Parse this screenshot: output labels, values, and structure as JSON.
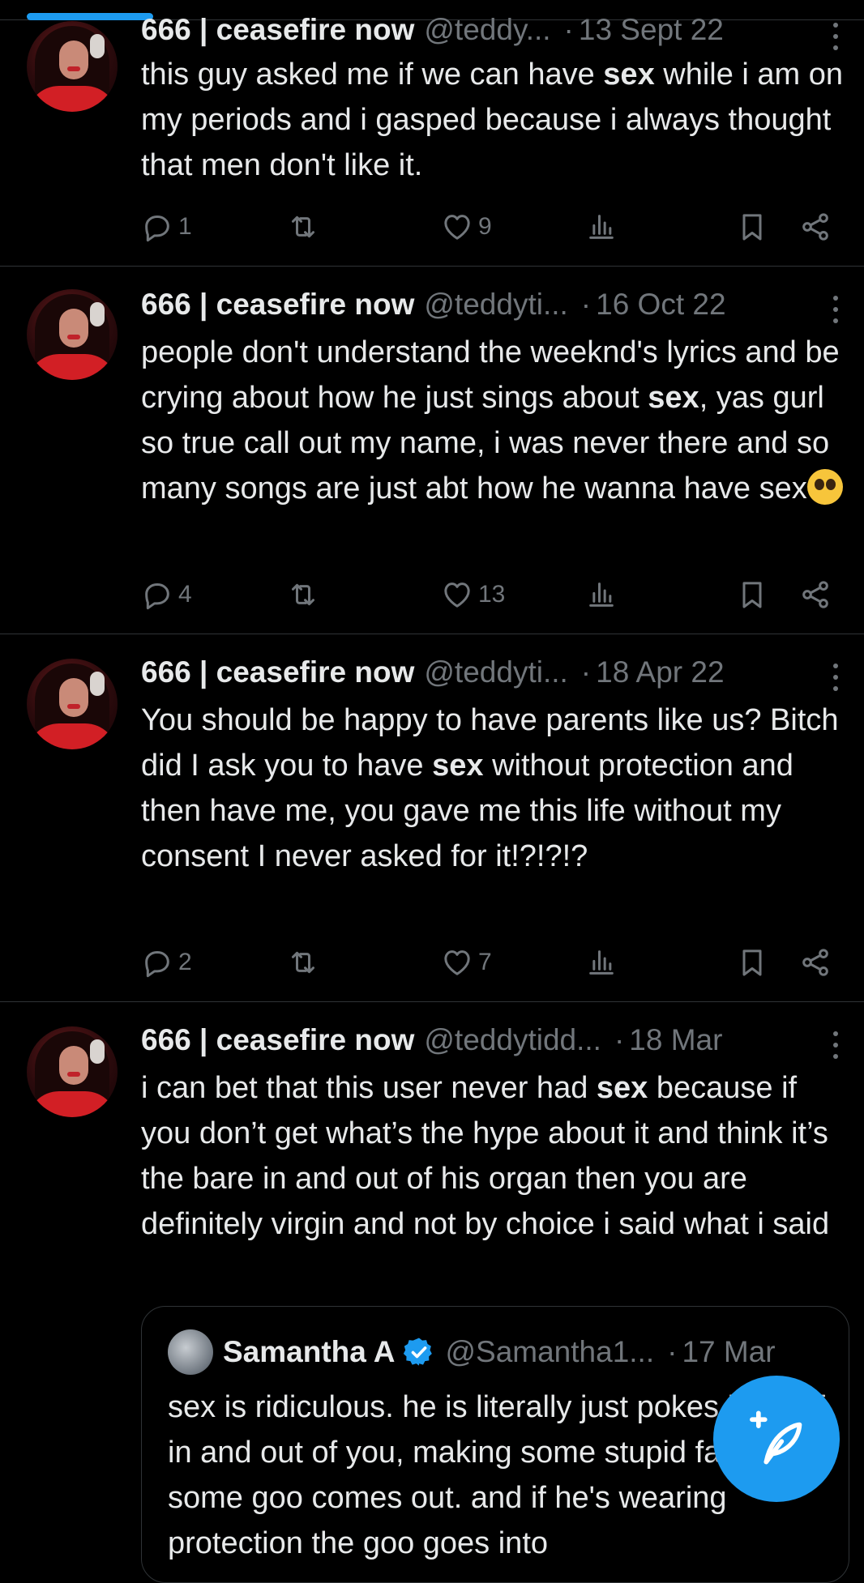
{
  "colors": {
    "accent": "#1d9bf0",
    "muted": "#71767b",
    "text": "#e7e9ea",
    "background": "#000000",
    "divider": "#2f3336"
  },
  "tweets": [
    {
      "name": "666 | ceasefire now",
      "handle": "@teddy...",
      "sep": "·",
      "date": "13 Sept 22",
      "text": [
        "this guy asked me if we can have ",
        "sex",
        " while i am on my periods and i gasped because i always thought that men don't like it."
      ],
      "replies": "1",
      "retweets": "",
      "likes": "9"
    },
    {
      "name": "666 | ceasefire now",
      "handle": "@teddyti...",
      "sep": "·",
      "date": "16 Oct 22",
      "text": [
        "people don't understand the weeknd's lyrics and be crying about how he just sings about ",
        "sex",
        ", yas gurl so true call out my name, i was never there and so many songs are just abt how he wanna have sex"
      ],
      "emoji": "pleading-face-emoji",
      "replies": "4",
      "retweets": "",
      "likes": "13"
    },
    {
      "name": "666 | ceasefire now",
      "handle": "@teddyti...",
      "sep": "·",
      "date": "18 Apr 22",
      "text": [
        "You should be happy to have parents like us? Bitch did I ask you to have ",
        "sex",
        " without protection and then have me, you gave me this life without my consent I never asked for it!?!?!?"
      ],
      "replies": "2",
      "retweets": "",
      "likes": "7"
    },
    {
      "name": "666 | ceasefire now",
      "handle": "@teddytidd...",
      "sep": "·",
      "date": "18 Mar",
      "text": [
        "i can bet that this user never had ",
        "sex",
        " because if you don’t get what’s the hype about it and think it’s the bare in and out of his organ then you are definitely virgin and not by choice i said what i said"
      ],
      "quote": {
        "name": "Samantha A",
        "handle": "@Samantha1...",
        "sep": "·",
        "date": "17 Mar",
        "text": "sex is ridiculous. he is literally just pokes himself in and out of you, making some stupid face, until some goo comes out. and if he's wearing protection the goo goes into"
      }
    }
  ],
  "icons": {
    "reply": "reply-icon",
    "retweet": "retweet-icon",
    "like": "like-icon",
    "views": "views-icon",
    "bookmark": "bookmark-icon",
    "share": "share-icon",
    "more": "more-icon",
    "compose": "compose-icon",
    "verified": "verified-badge-icon"
  }
}
